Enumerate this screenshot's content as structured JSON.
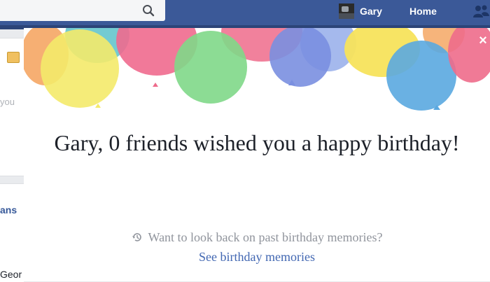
{
  "topbar": {
    "search_placeholder": "",
    "profile_name": "Gary",
    "home_label": "Home"
  },
  "background": {
    "fragment_you": "you",
    "fragment_ans": "ans",
    "fragment_geo": "Geor"
  },
  "modal": {
    "headline": "Gary, 0 friends wished you a happy birthday!",
    "memories_prompt": "Want to look back on past birthday memories?",
    "memories_link": "See birthday memories",
    "close_label": "×"
  },
  "colors": {
    "facebook_blue": "#3b5998",
    "link_blue": "#4267b2",
    "heading_text": "#1d2129",
    "muted_text": "#90949c"
  },
  "icons": {
    "search": "search-icon",
    "avatar": "avatar",
    "friends": "friends-icon",
    "close": "close-icon",
    "history": "clock-history-icon"
  }
}
